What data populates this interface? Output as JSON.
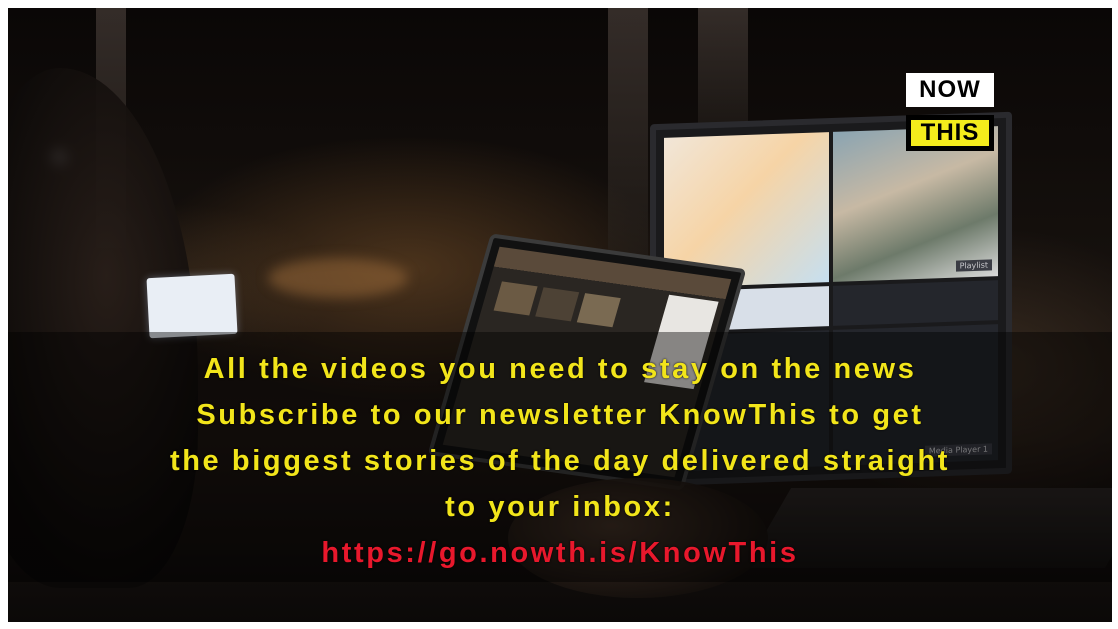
{
  "logo": {
    "top_text": "NOW",
    "bottom_text": "THIS"
  },
  "monitor": {
    "tile_labels": [
      "Playlist",
      "Media Player 1"
    ]
  },
  "caption": {
    "line1": "All the videos you need to stay on the news",
    "line2": "Subscribe to our newsletter KnowThis to get",
    "line3": "the biggest stories of the day delivered straight",
    "line4": "to your inbox:",
    "link": "https://go.nowth.is/KnowThis"
  },
  "colors": {
    "caption_text": "#f2e51a",
    "link_text": "#e8182c",
    "logo_accent": "#f4ec1c"
  }
}
